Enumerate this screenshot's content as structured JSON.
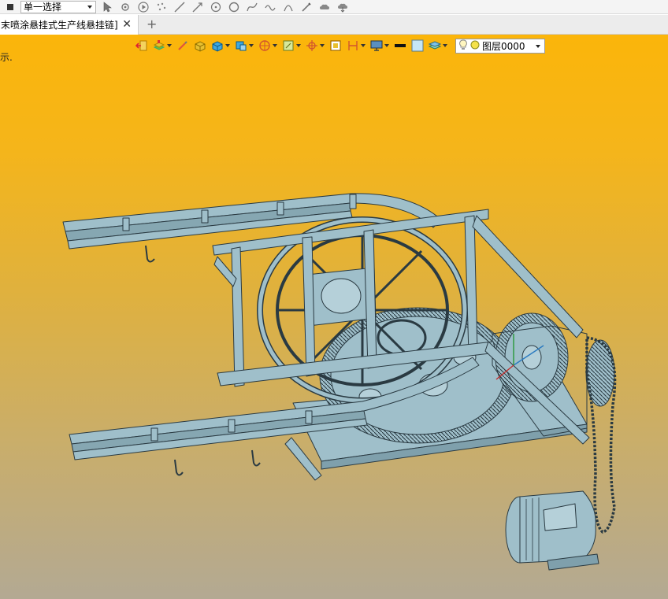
{
  "toolbar": {
    "selection_mode": "单一选择",
    "icons": [
      "select-arrow-icon",
      "pick-point-icon",
      "play-icon",
      "scatter-points-icon",
      "line-icon",
      "line-arrow-icon",
      "circle-point-icon",
      "circle-icon",
      "spline-icon",
      "wave-icon",
      "arc-icon",
      "pen-icon",
      "cloud-icon",
      "cloud-download-icon"
    ]
  },
  "tabs": {
    "active_title": "末喷涂悬挂式生产线悬挂链]",
    "close_glyph": "✕",
    "add_glyph": "+"
  },
  "viewport": {
    "hint_text": "示.",
    "layer": {
      "name": "图层0000"
    },
    "colors": {
      "bg_top": "#fbb50a",
      "bg_bottom": "#b3a993",
      "model_fill": "#9fbfca",
      "model_stroke": "#2a3a42"
    }
  }
}
